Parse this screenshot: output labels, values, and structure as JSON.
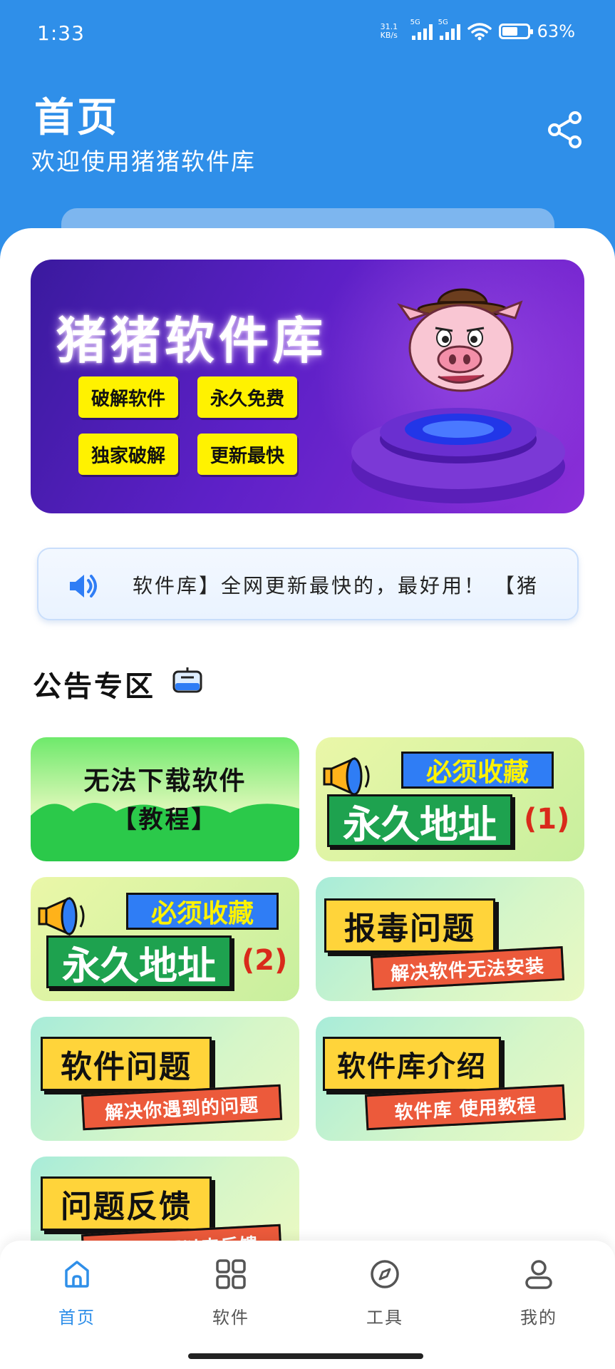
{
  "status_bar": {
    "time": "1:33",
    "net_speed": "31.1\nKB/s",
    "net_type_1": "5G",
    "net_type_2": "5G",
    "battery_percent": "63%",
    "battery_level": 0.63
  },
  "header": {
    "title": "首页",
    "subtitle": "欢迎使用猪猪软件库",
    "share_icon": "share-icon"
  },
  "banner": {
    "title": "猪猪软件库",
    "tags": [
      "破解软件",
      "永久免费",
      "独家破解",
      "更新最快"
    ]
  },
  "marquee": {
    "icon": "speaker-icon",
    "text": "软件库】全网更新最快的，最好用！ 【猪"
  },
  "section": {
    "title": "公告专区",
    "icon": "board-icon"
  },
  "cards": [
    {
      "title": "无法下载软件",
      "subtitle": "【教程】"
    },
    {
      "top": "必须收藏",
      "main": "永久地址",
      "num": "(1)"
    },
    {
      "top": "必须收藏",
      "main": "永久地址",
      "num": "(2)"
    },
    {
      "title": "报毒问题",
      "subtitle": "解决软件无法安装"
    },
    {
      "title": "软件问题",
      "subtitle": "解决你遇到的问题"
    },
    {
      "title": "软件库介绍",
      "subtitle": "软件库 使用教程"
    },
    {
      "title": "问题反馈",
      "subtitle": "有问题可以来反馈"
    }
  ],
  "bottom_nav": [
    {
      "label": "首页",
      "icon": "home-icon",
      "active": true
    },
    {
      "label": "软件",
      "icon": "grid-icon",
      "active": false
    },
    {
      "label": "工具",
      "icon": "compass-icon",
      "active": false
    },
    {
      "label": "我的",
      "icon": "user-icon",
      "active": false
    }
  ],
  "colors": {
    "primary": "#2f8fe9",
    "banner_purple": "#5d20c7",
    "tag_yellow": "#fff200"
  }
}
